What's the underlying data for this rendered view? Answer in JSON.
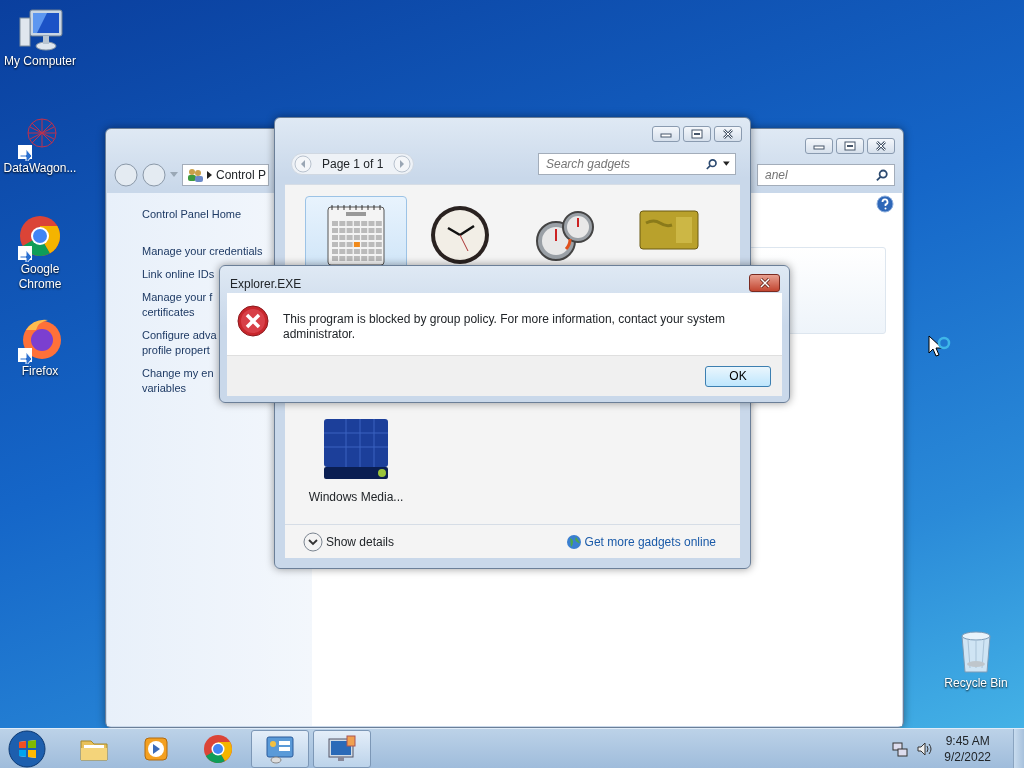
{
  "desktop_icons": [
    {
      "kind": "computer",
      "label": "My Computer"
    },
    {
      "kind": "datawagon",
      "label": "DataWagon..."
    },
    {
      "kind": "chrome",
      "label": "Google Chrome"
    },
    {
      "kind": "firefox",
      "label": "Firefox"
    },
    {
      "kind": "recycle",
      "label": "Recycle Bin"
    }
  ],
  "control_panel_window": {
    "address": "Control P",
    "search_placeholder": "anel",
    "links": [
      {
        "lines": [
          "Control Panel Home"
        ]
      },
      {
        "lines": [
          "Manage your credentials"
        ]
      },
      {
        "lines": [
          "Link online IDs"
        ]
      },
      {
        "lines": [
          "Manage your f",
          "certificates"
        ]
      },
      {
        "lines": [
          "Configure adva",
          "profile propert"
        ]
      },
      {
        "lines": [
          "Change my en",
          "variables"
        ]
      }
    ]
  },
  "gadgets_window": {
    "page": "Page 1 of 1",
    "search_placeholder": "Search gadgets",
    "gadgets": [
      {
        "kind": "calendar",
        "selected": true
      },
      {
        "kind": "clock",
        "selected": false
      },
      {
        "kind": "meter",
        "selected": false
      },
      {
        "kind": "currency",
        "selected": false
      },
      {
        "kind": "media",
        "label": "Windows Media...",
        "selected": false
      }
    ],
    "show_details": "Show details",
    "online_link": "Get more gadgets online"
  },
  "dialog": {
    "title": "Explorer.EXE",
    "message": "This program is blocked by group policy. For more information, contact your system administrator.",
    "button": "OK"
  },
  "taskbar": {
    "items": [
      {
        "kind": "explorer",
        "active": false
      },
      {
        "kind": "media-player",
        "active": false
      },
      {
        "kind": "chrome",
        "active": false
      },
      {
        "kind": "control-panel",
        "active": true
      },
      {
        "kind": "gadgets",
        "active": true
      }
    ],
    "time": "9:45 AM",
    "date": "9/2/2022"
  }
}
